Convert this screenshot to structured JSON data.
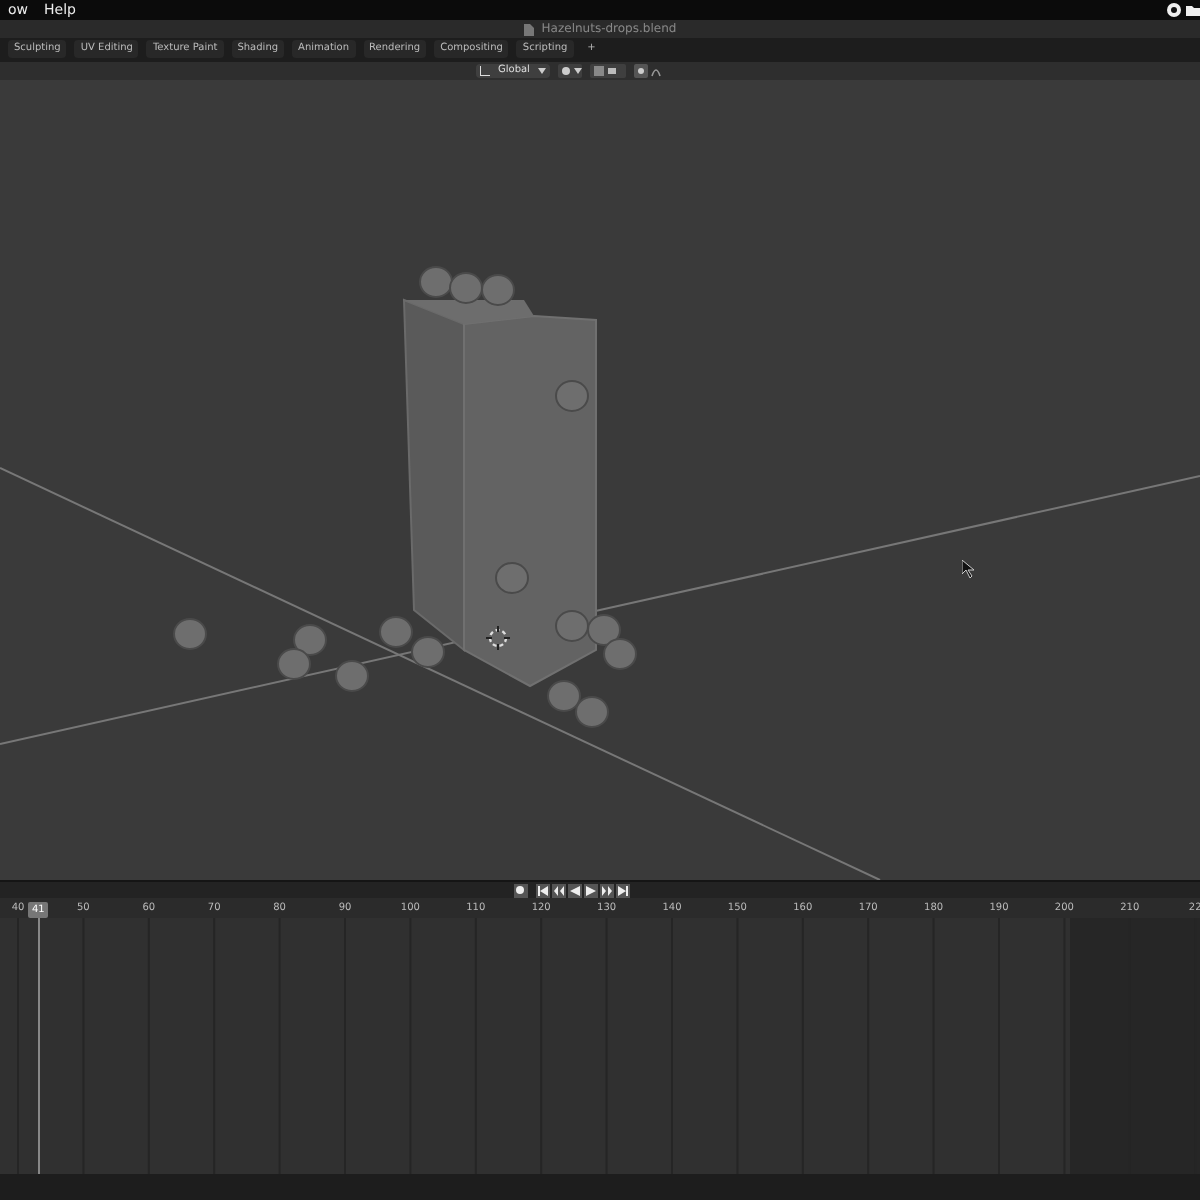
{
  "menu_bar": {
    "menus": [
      "ow",
      "Help"
    ]
  },
  "title_bar": {
    "filename": "Hazelnuts-drops.blend"
  },
  "workspace_tabs": [
    {
      "label": "Sculpting"
    },
    {
      "label": "UV Editing"
    },
    {
      "label": "Texture Paint"
    },
    {
      "label": "Shading"
    },
    {
      "label": "Animation"
    },
    {
      "label": "Rendering"
    },
    {
      "label": "Compositing"
    },
    {
      "label": "Scripting"
    }
  ],
  "add_tab": "+",
  "viewport_header": {
    "orientation": "Global"
  },
  "timeline": {
    "ruler": [
      "40",
      "50",
      "60",
      "70",
      "80",
      "90",
      "100",
      "110",
      "120",
      "130",
      "140",
      "150",
      "160",
      "170",
      "180",
      "190",
      "200",
      "210",
      "22"
    ],
    "current_frame": "41"
  }
}
